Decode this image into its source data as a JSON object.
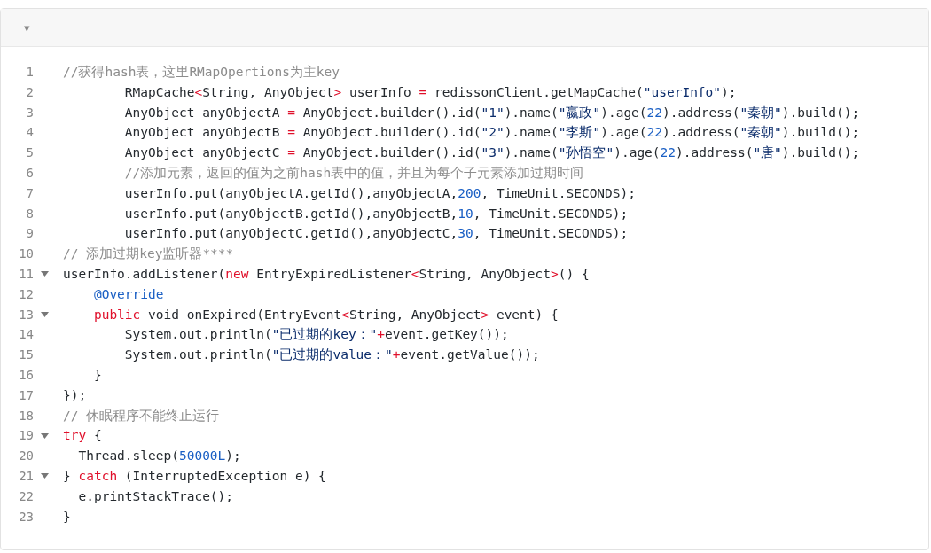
{
  "toolbar": {
    "collapse_caret": "▾"
  },
  "code": {
    "lines": [
      {
        "number": "1",
        "foldable": false,
        "tokens": [
          {
            "kind": "comment",
            "text": "//获得hash表，这里RMapOpertions为主key"
          }
        ]
      },
      {
        "number": "2",
        "foldable": false,
        "tokens": [
          {
            "kind": "plain",
            "text": "        RMapCache"
          },
          {
            "kind": "operator",
            "text": "<"
          },
          {
            "kind": "plain",
            "text": "String, AnyObject"
          },
          {
            "kind": "operator",
            "text": ">"
          },
          {
            "kind": "plain",
            "text": " userInfo "
          },
          {
            "kind": "operator",
            "text": "="
          },
          {
            "kind": "plain",
            "text": " redissonClient.getMapCache("
          },
          {
            "kind": "string",
            "text": "\"userInfo\""
          },
          {
            "kind": "plain",
            "text": ");"
          }
        ]
      },
      {
        "number": "3",
        "foldable": false,
        "tokens": [
          {
            "kind": "plain",
            "text": "        AnyObject anyObjectA "
          },
          {
            "kind": "operator",
            "text": "="
          },
          {
            "kind": "plain",
            "text": " AnyObject.builder().id("
          },
          {
            "kind": "string",
            "text": "\"1\""
          },
          {
            "kind": "plain",
            "text": ").name("
          },
          {
            "kind": "string",
            "text": "\"嬴政\""
          },
          {
            "kind": "plain",
            "text": ").age("
          },
          {
            "kind": "number",
            "text": "22"
          },
          {
            "kind": "plain",
            "text": ").address("
          },
          {
            "kind": "string",
            "text": "\"秦朝\""
          },
          {
            "kind": "plain",
            "text": ").build();"
          }
        ]
      },
      {
        "number": "4",
        "foldable": false,
        "tokens": [
          {
            "kind": "plain",
            "text": "        AnyObject anyObjectB "
          },
          {
            "kind": "operator",
            "text": "="
          },
          {
            "kind": "plain",
            "text": " AnyObject.builder().id("
          },
          {
            "kind": "string",
            "text": "\"2\""
          },
          {
            "kind": "plain",
            "text": ").name("
          },
          {
            "kind": "string",
            "text": "\"李斯\""
          },
          {
            "kind": "plain",
            "text": ").age("
          },
          {
            "kind": "number",
            "text": "22"
          },
          {
            "kind": "plain",
            "text": ").address("
          },
          {
            "kind": "string",
            "text": "\"秦朝\""
          },
          {
            "kind": "plain",
            "text": ").build();"
          }
        ]
      },
      {
        "number": "5",
        "foldable": false,
        "tokens": [
          {
            "kind": "plain",
            "text": "        AnyObject anyObjectC "
          },
          {
            "kind": "operator",
            "text": "="
          },
          {
            "kind": "plain",
            "text": " AnyObject.builder().id("
          },
          {
            "kind": "string",
            "text": "\"3\""
          },
          {
            "kind": "plain",
            "text": ").name("
          },
          {
            "kind": "string",
            "text": "\"孙悟空\""
          },
          {
            "kind": "plain",
            "text": ").age("
          },
          {
            "kind": "number",
            "text": "22"
          },
          {
            "kind": "plain",
            "text": ").address("
          },
          {
            "kind": "string",
            "text": "\"唐\""
          },
          {
            "kind": "plain",
            "text": ").build();"
          }
        ]
      },
      {
        "number": "6",
        "foldable": false,
        "tokens": [
          {
            "kind": "comment",
            "text": "        //添加元素，返回的值为之前hash表中的值，并且为每个子元素添加过期时间"
          }
        ]
      },
      {
        "number": "7",
        "foldable": false,
        "tokens": [
          {
            "kind": "plain",
            "text": "        userInfo.put(anyObjectA.getId(),anyObjectA,"
          },
          {
            "kind": "number",
            "text": "200"
          },
          {
            "kind": "plain",
            "text": ", TimeUnit.SECONDS);"
          }
        ]
      },
      {
        "number": "8",
        "foldable": false,
        "tokens": [
          {
            "kind": "plain",
            "text": "        userInfo.put(anyObjectB.getId(),anyObjectB,"
          },
          {
            "kind": "number",
            "text": "10"
          },
          {
            "kind": "plain",
            "text": ", TimeUnit.SECONDS);"
          }
        ]
      },
      {
        "number": "9",
        "foldable": false,
        "tokens": [
          {
            "kind": "plain",
            "text": "        userInfo.put(anyObjectC.getId(),anyObjectC,"
          },
          {
            "kind": "number",
            "text": "30"
          },
          {
            "kind": "plain",
            "text": ", TimeUnit.SECONDS);"
          }
        ]
      },
      {
        "number": "10",
        "foldable": false,
        "tokens": [
          {
            "kind": "comment",
            "text": "// 添加过期key监听器****"
          }
        ]
      },
      {
        "number": "11",
        "foldable": true,
        "tokens": [
          {
            "kind": "plain",
            "text": "userInfo.addListener("
          },
          {
            "kind": "keyword",
            "text": "new"
          },
          {
            "kind": "plain",
            "text": " EntryExpiredListener"
          },
          {
            "kind": "operator",
            "text": "<"
          },
          {
            "kind": "plain",
            "text": "String, AnyObject"
          },
          {
            "kind": "operator",
            "text": ">"
          },
          {
            "kind": "plain",
            "text": "() {"
          }
        ]
      },
      {
        "number": "12",
        "foldable": false,
        "tokens": [
          {
            "kind": "annotation",
            "text": "    @Override"
          }
        ]
      },
      {
        "number": "13",
        "foldable": true,
        "tokens": [
          {
            "kind": "keyword",
            "text": "    public"
          },
          {
            "kind": "plain",
            "text": " void onExpired(EntryEvent"
          },
          {
            "kind": "operator",
            "text": "<"
          },
          {
            "kind": "plain",
            "text": "String, AnyObject"
          },
          {
            "kind": "operator",
            "text": ">"
          },
          {
            "kind": "plain",
            "text": " event) {"
          }
        ]
      },
      {
        "number": "14",
        "foldable": false,
        "tokens": [
          {
            "kind": "plain",
            "text": "        System.out.println("
          },
          {
            "kind": "string",
            "text": "\"已过期的key：\""
          },
          {
            "kind": "operator",
            "text": "+"
          },
          {
            "kind": "plain",
            "text": "event.getKey());"
          }
        ]
      },
      {
        "number": "15",
        "foldable": false,
        "tokens": [
          {
            "kind": "plain",
            "text": "        System.out.println("
          },
          {
            "kind": "string",
            "text": "\"已过期的value：\""
          },
          {
            "kind": "operator",
            "text": "+"
          },
          {
            "kind": "plain",
            "text": "event.getValue());"
          }
        ]
      },
      {
        "number": "16",
        "foldable": false,
        "tokens": [
          {
            "kind": "plain",
            "text": "    }"
          }
        ]
      },
      {
        "number": "17",
        "foldable": false,
        "tokens": [
          {
            "kind": "plain",
            "text": "});"
          }
        ]
      },
      {
        "number": "18",
        "foldable": false,
        "tokens": [
          {
            "kind": "comment",
            "text": "// 休眠程序不能终止运行"
          }
        ]
      },
      {
        "number": "19",
        "foldable": true,
        "tokens": [
          {
            "kind": "keyword",
            "text": "try"
          },
          {
            "kind": "plain",
            "text": " {"
          }
        ]
      },
      {
        "number": "20",
        "foldable": false,
        "tokens": [
          {
            "kind": "plain",
            "text": "  Thread.sleep("
          },
          {
            "kind": "number",
            "text": "50000L"
          },
          {
            "kind": "plain",
            "text": ");"
          }
        ]
      },
      {
        "number": "21",
        "foldable": true,
        "tokens": [
          {
            "kind": "plain",
            "text": "} "
          },
          {
            "kind": "keyword",
            "text": "catch"
          },
          {
            "kind": "plain",
            "text": " (InterruptedException e) {"
          }
        ]
      },
      {
        "number": "22",
        "foldable": false,
        "tokens": [
          {
            "kind": "plain",
            "text": "  e.printStackTrace();"
          }
        ]
      },
      {
        "number": "23",
        "foldable": false,
        "tokens": [
          {
            "kind": "plain",
            "text": "}"
          }
        ]
      }
    ]
  }
}
